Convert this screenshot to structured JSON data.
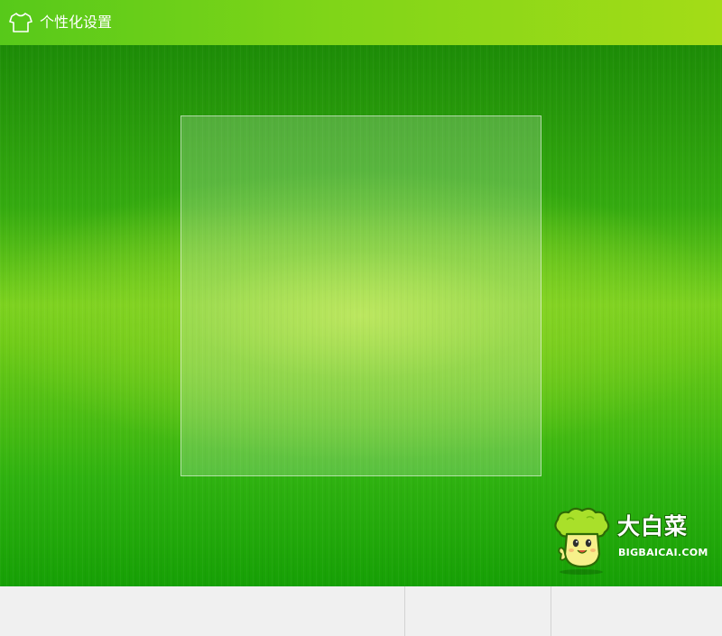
{
  "window": {
    "title": "个性化设置",
    "title_icon": "tshirt-icon"
  },
  "stage": {
    "background": "green-texture",
    "accent_color": "#3aa80c",
    "preview_area": "wallpaper-preview"
  },
  "logo": {
    "brand": "大白菜",
    "url": "BIGBAICAI.COM",
    "mascot_icon": "cabbage-mascot-icon"
  },
  "footer": {
    "sections": [
      "",
      "",
      ""
    ]
  },
  "colors": {
    "titlebar_start": "#57c91a",
    "titlebar_end": "#a4dc17",
    "footer_bg": "#f0f0f0"
  }
}
